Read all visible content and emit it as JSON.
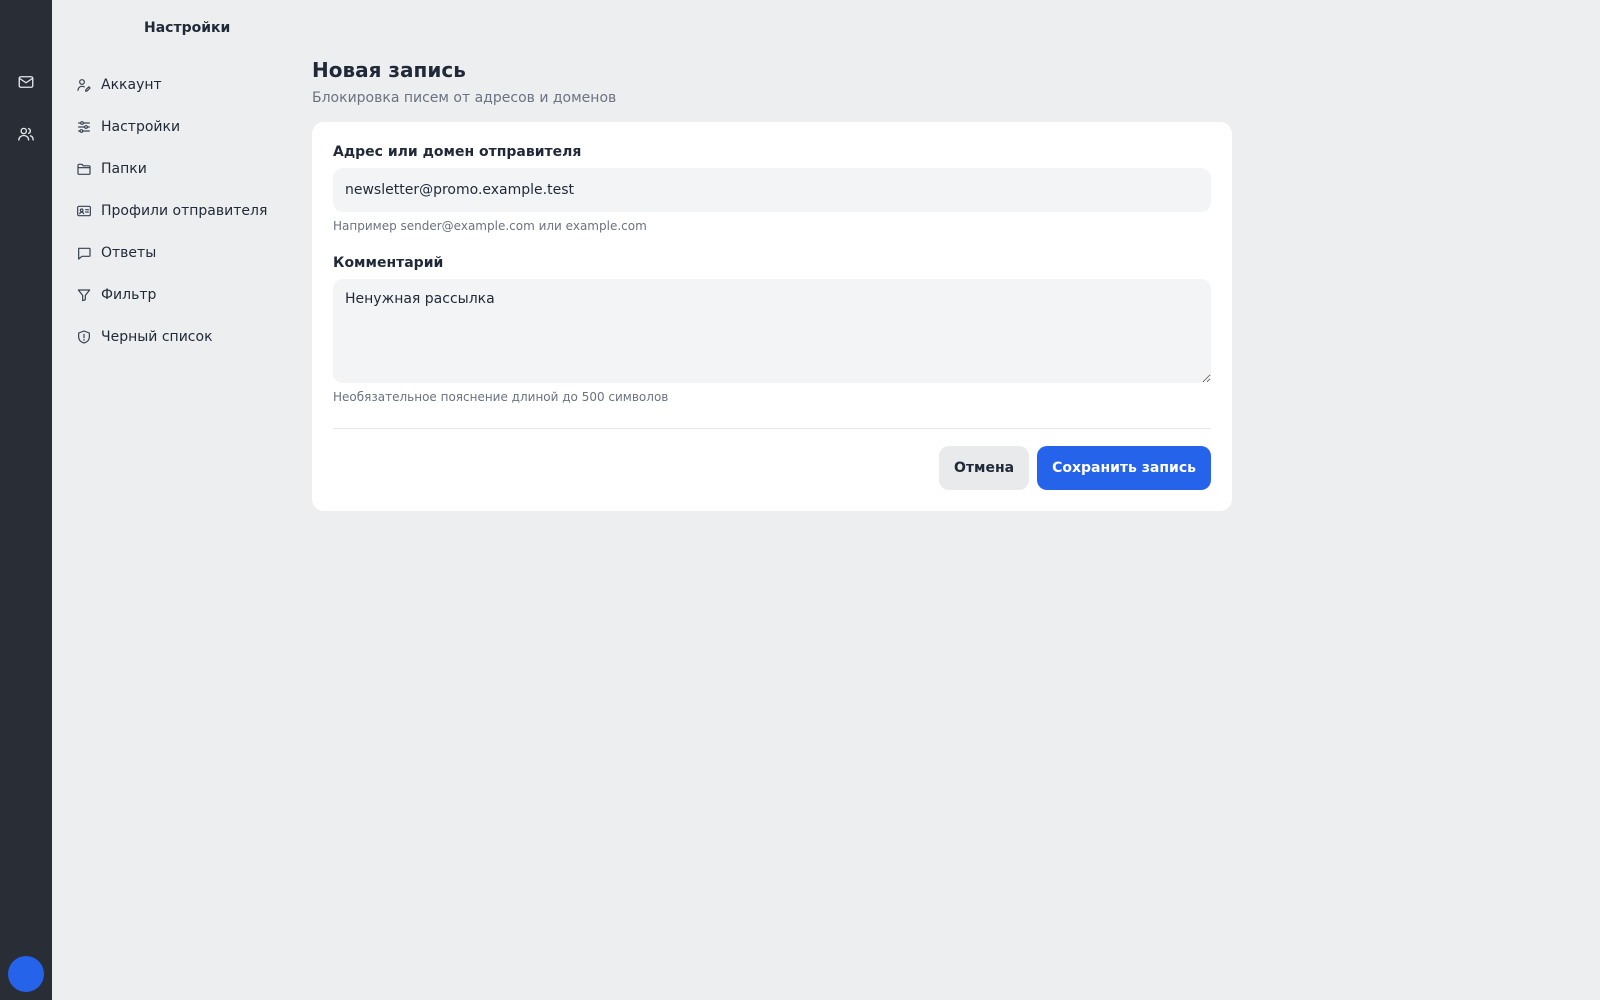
{
  "rail": {
    "items": [
      {
        "icon": "mail-icon"
      },
      {
        "icon": "users-icon"
      }
    ]
  },
  "settings": {
    "title": "Настройки",
    "items": [
      {
        "label": "Аккаунт",
        "icon": "account-icon"
      },
      {
        "label": "Настройки",
        "icon": "sliders-icon"
      },
      {
        "label": "Папки",
        "icon": "folder-icon"
      },
      {
        "label": "Профили отправителя",
        "icon": "id-card-icon"
      },
      {
        "label": "Ответы",
        "icon": "message-icon"
      },
      {
        "label": "Фильтр",
        "icon": "filter-icon"
      },
      {
        "label": "Черный список",
        "icon": "shield-icon"
      }
    ]
  },
  "page": {
    "title": "Новая запись",
    "subtitle": "Блокировка писем от адресов и доменов"
  },
  "form": {
    "sender": {
      "label": "Адрес или домен отправителя",
      "value": "newsletter@promo.example.test",
      "hint": "Например sender@example.com или example.com"
    },
    "comment": {
      "label": "Комментарий",
      "value": "Ненужная рассылка",
      "hint": "Необязательное пояснение длиной до 500 символов"
    },
    "cancel_label": "Отмена",
    "save_label": "Сохранить запись"
  },
  "colors": {
    "rail": "#282d36",
    "accent": "#2563eb",
    "background": "#edeef0"
  }
}
